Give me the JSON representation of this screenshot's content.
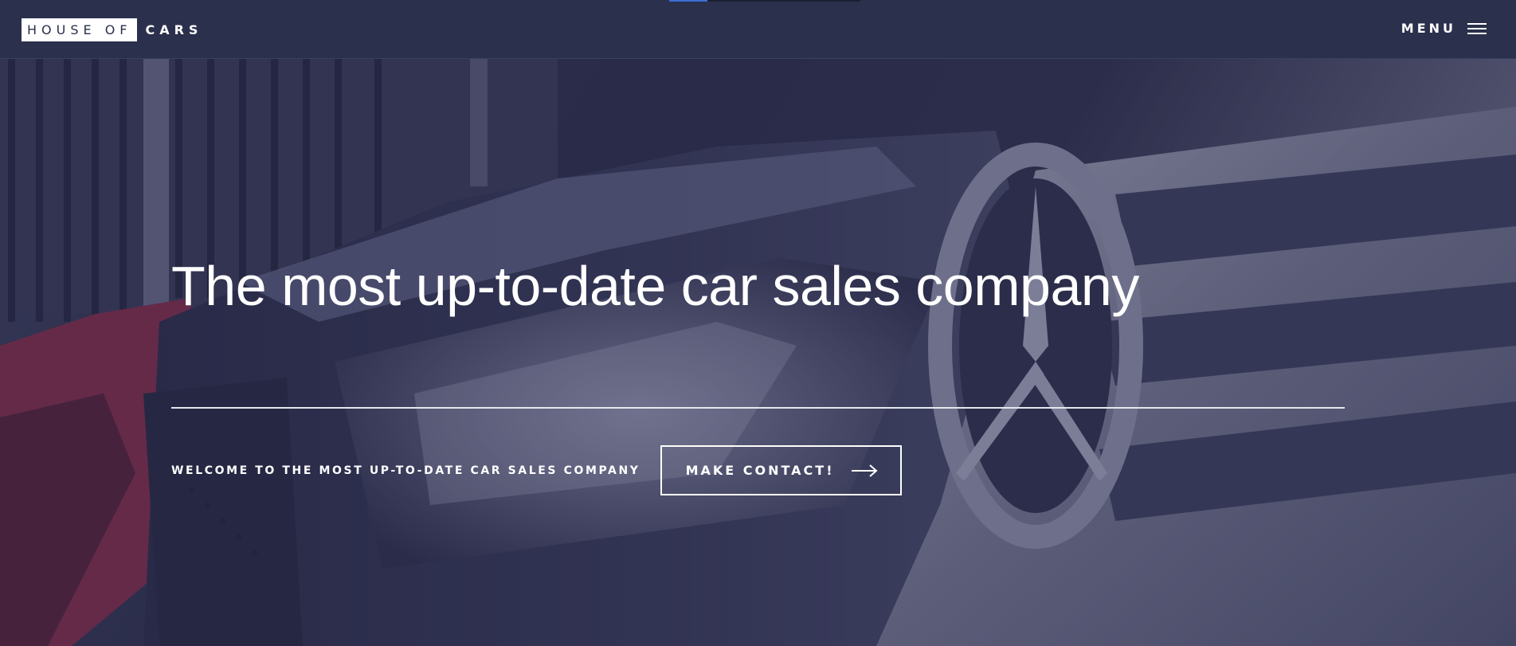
{
  "header": {
    "logo_boxed": "HOUSE OF",
    "logo_rest": "CARS",
    "menu_label": "MENU",
    "menu_icon": "hamburger-icon"
  },
  "hero": {
    "title": "The most up-to-date car sales company",
    "subtitle": "WELCOME TO THE MOST UP-TO-DATE CAR SALES COMPANY",
    "cta_label": "MAKE CONTACT!",
    "cta_icon": "arrow-right-icon",
    "background_image": "close-up of parked cars (headlights and grille)"
  },
  "colors": {
    "header_bg": "#2b304c",
    "hero_overlay": "#282a4e",
    "accent": "#3f6fd6",
    "text": "#ffffff"
  }
}
